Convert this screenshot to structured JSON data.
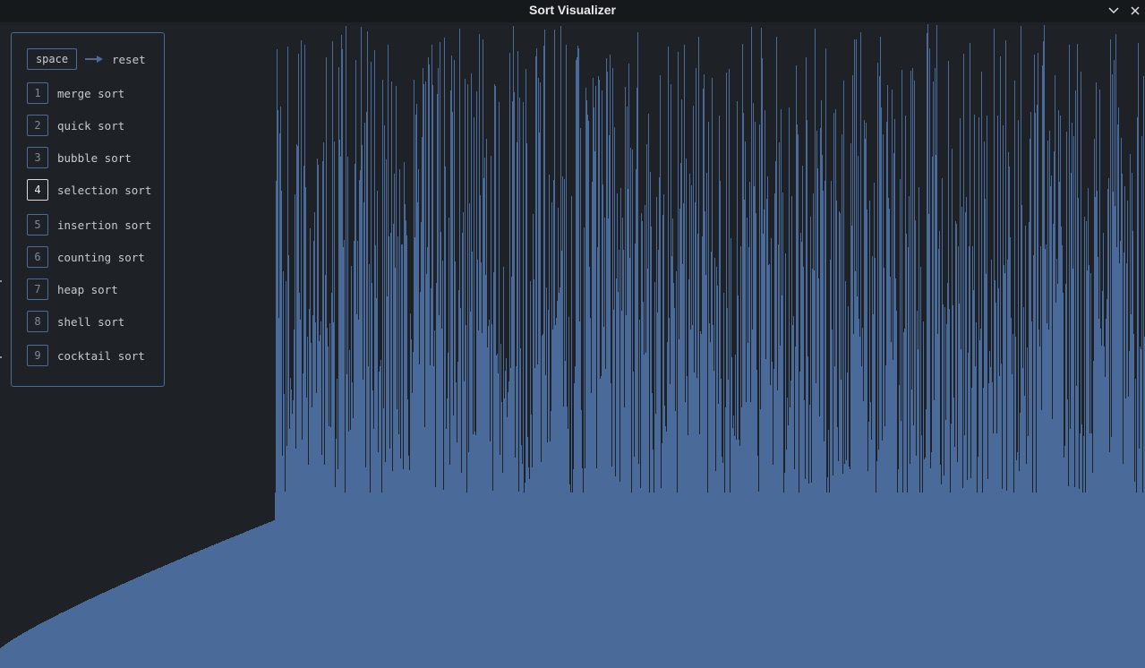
{
  "window": {
    "title": "Sort Visualizer",
    "controls": [
      "chevron-down-icon",
      "close-icon"
    ]
  },
  "colors": {
    "background": "#1e2227",
    "titlebar": "#15191c",
    "bar": "#4a6a9a",
    "panel_border": "#4b6a99"
  },
  "controls_panel": {
    "reset": {
      "key": "space",
      "label": "reset"
    },
    "algorithms": [
      {
        "key": "1",
        "label": "merge sort",
        "active": false
      },
      {
        "key": "2",
        "label": "quick sort",
        "active": false
      },
      {
        "key": "3",
        "label": "bubble sort",
        "active": false
      },
      {
        "key": "4",
        "label": "selection sort",
        "active": true
      },
      {
        "key": "5",
        "label": "insertion sort",
        "active": false
      },
      {
        "key": "6",
        "label": "counting sort",
        "active": false
      },
      {
        "key": "7",
        "label": "heap sort",
        "active": false
      },
      {
        "key": "8",
        "label": "shell sort",
        "active": false
      },
      {
        "key": "9",
        "label": "cocktail sort",
        "active": false
      }
    ]
  },
  "visualization": {
    "algorithm_running": "selection sort",
    "sorted_fraction": 0.24
  }
}
